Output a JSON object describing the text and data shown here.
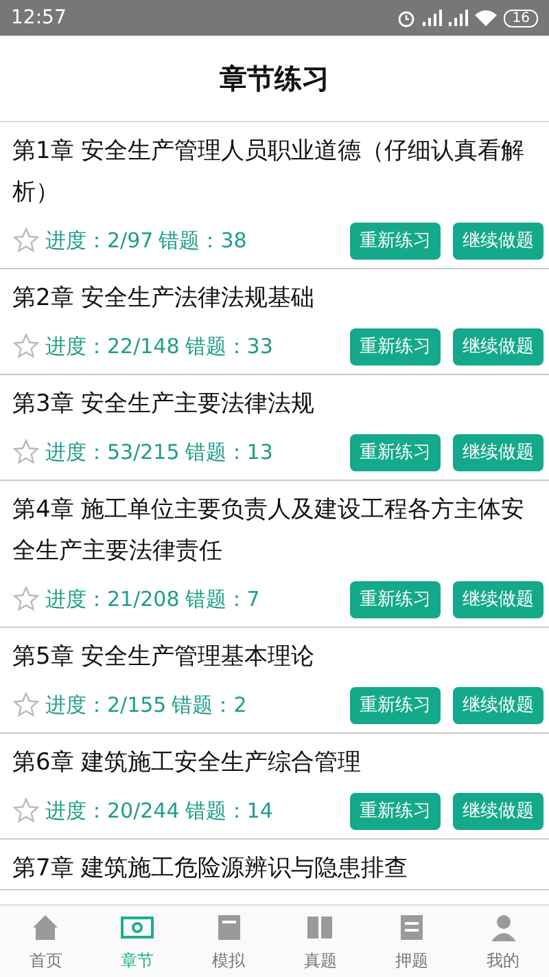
{
  "status_bar": {
    "time": "12:57",
    "battery": "16"
  },
  "header": {
    "title": "章节练习"
  },
  "chapters": [
    {
      "title": "第1章 安全生产管理人员职业道德（仔细认真看解析）",
      "starred": false,
      "progress": "进度：2/97",
      "errors": "错题：38",
      "buttons": [
        "重新练习",
        "继续做题"
      ]
    },
    {
      "title": "第2章 安全生产法律法规基础",
      "starred": false,
      "progress": "进度：22/148",
      "errors": "错题：33",
      "buttons": [
        "重新练习",
        "继续做题"
      ]
    },
    {
      "title": "第3章 安全生产主要法律法规",
      "starred": false,
      "progress": "进度：53/215",
      "errors": "错题：13",
      "buttons": [
        "重新练习",
        "继续做题"
      ]
    },
    {
      "title": "第4章 施工单位主要负责人及建设工程各方主体安全生产主要法律责任",
      "starred": false,
      "progress": "进度：21/208",
      "errors": "错题：7",
      "buttons": [
        "重新练习",
        "继续做题"
      ]
    },
    {
      "title": "第5章 安全生产管理基本理论",
      "starred": false,
      "progress": "进度：2/155",
      "errors": "错题：2",
      "buttons": [
        "重新练习",
        "继续做题"
      ]
    },
    {
      "title": "第6章 建筑施工安全生产综合管理",
      "starred": false,
      "progress": "进度：20/244",
      "errors": "错题：14",
      "buttons": [
        "重新练习",
        "继续做题"
      ]
    },
    {
      "title": "第7章 建筑施工危险源辨识与隐患排查"
    }
  ],
  "nav": [
    {
      "label": "首页",
      "selected": false
    },
    {
      "label": "章节",
      "selected": true
    },
    {
      "label": "模拟",
      "selected": false
    },
    {
      "label": "真题",
      "selected": false
    },
    {
      "label": "押题",
      "selected": false
    },
    {
      "label": "我的",
      "selected": false
    }
  ]
}
